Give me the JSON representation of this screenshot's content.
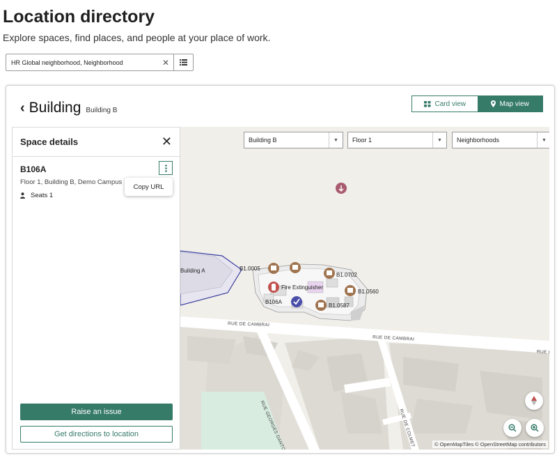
{
  "page": {
    "title": "Location directory",
    "subtitle": "Explore spaces, find places, and people at your place of work."
  },
  "filter": {
    "value": "HR Global neighborhood, Neighborhood",
    "clear_icon": "close-icon",
    "list_icon": "list-icon"
  },
  "building": {
    "title": "Building",
    "subtitle": "Building B"
  },
  "views": {
    "card_label": "Card view",
    "map_label": "Map view",
    "active": "Map view"
  },
  "details": {
    "title": "Space details",
    "space_name": "B106A",
    "location": "Floor 1, Building B, Demo Campus",
    "seats_label": "Seats 1",
    "copy_url_label": "Copy URL",
    "raise_issue_label": "Raise an issue",
    "directions_label": "Get directions to location"
  },
  "map": {
    "building_select": "Building B",
    "floor_select": "Floor 1",
    "neighborhood_select": "Neighborhoods",
    "labels": {
      "building_a": "Building A",
      "b1_0005": "B1.0005",
      "b1_0702": "B1.0702",
      "fire_ext": "Fire Extinguisher",
      "b1_0560": "B1.0560",
      "b106a": "B106A",
      "b1_0587": "B1.0587"
    },
    "streets": {
      "cambrai_1": "RUE DE CAMBRAI",
      "cambrai_2": "RUE DE CAMBRAI",
      "cambrai_3": "RUE D",
      "danton": "RUE GEORGES DANTON",
      "colmet": "RUE DE COLMET"
    },
    "attribution": "© OpenMapTiles © OpenStreetMap contributors"
  },
  "colors": {
    "accent": "#367a68",
    "marker_brown": "#a0744f",
    "marker_red": "#c0524e",
    "marker_blue": "#4a4fa8",
    "building_a_outline": "#3b3f9e"
  }
}
